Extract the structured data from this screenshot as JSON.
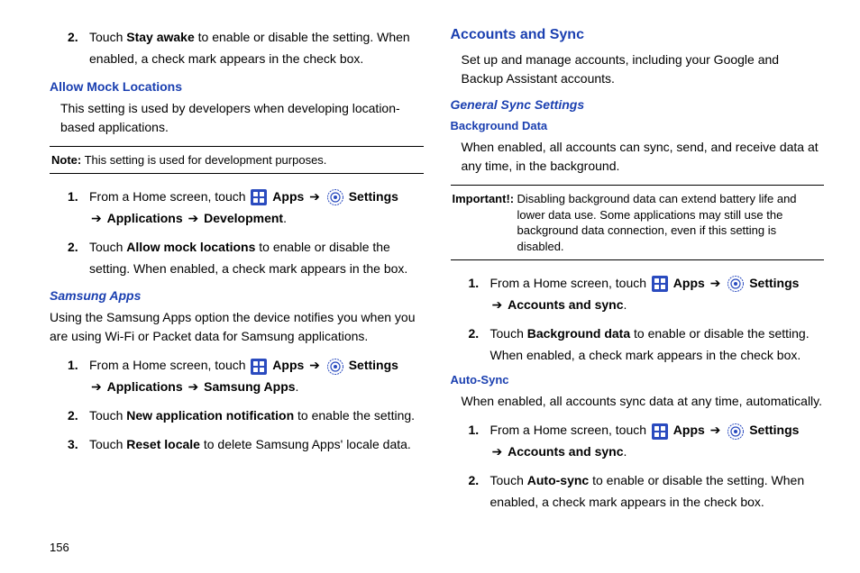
{
  "pagenum": "156",
  "left": {
    "stayawake": {
      "num": "2.",
      "text_a": "Touch ",
      "bold": "Stay awake",
      "text_b": " to enable or disable the setting. When enabled, a check mark appears in the check box."
    },
    "allowmock_head": "Allow Mock Locations",
    "allowmock_para": "This setting is used by developers when developing location-based applications.",
    "note_label": "Note:",
    "note_text": " This setting is used for development purposes.",
    "mock_steps": {
      "s1": {
        "num": "1.",
        "pre": "From a Home screen, touch ",
        "apps": "Apps",
        "sep": " ➔ ",
        "settings": "Settings",
        "sep2": " ➔ ",
        "applications": "Applications",
        "sep3": " ➔ ",
        "dev": "Development",
        "end": "."
      },
      "s2": {
        "num": "2.",
        "pre": "Touch ",
        "bold": "Allow mock locations",
        "post": " to enable or disable the setting. When enabled, a check mark appears in the box."
      }
    },
    "samsung_head": "Samsung Apps",
    "samsung_para": "Using the Samsung Apps option the device notifies you when you are using Wi-Fi or Packet data for Samsung applications.",
    "samsung_steps": {
      "s1": {
        "num": "1.",
        "pre": "From a Home screen, touch ",
        "apps": "Apps",
        "sep": " ➔ ",
        "settings": "Settings",
        "sep2": " ➔ ",
        "applications": "Applications",
        "sep3": " ➔ ",
        "sa": "Samsung Apps",
        "end": "."
      },
      "s2": {
        "num": "2.",
        "pre": "Touch ",
        "bold": "New application notification",
        "post": " to enable the setting."
      },
      "s3": {
        "num": "3.",
        "pre": "Touch ",
        "bold": "Reset locale",
        "post": " to delete Samsung Apps' locale data."
      }
    }
  },
  "right": {
    "accounts_head": "Accounts and Sync",
    "accounts_para": "Set up and manage accounts, including your Google and Backup Assistant accounts.",
    "general_head": "General Sync Settings",
    "bgdata_head": "Background Data",
    "bgdata_para": "When enabled, all accounts can sync, send, and receive data at any time, in the background.",
    "important_label": "Important!:",
    "important_text": "Disabling background data can extend battery life and lower data use. Some applications may still use the background data connection, even if this setting is disabled.",
    "bg_steps": {
      "s1": {
        "num": "1.",
        "pre": "From a Home screen, touch ",
        "apps": "Apps",
        "sep": " ➔ ",
        "settings": "Settings",
        "sep2": " ➔ ",
        "acct": "Accounts and sync",
        "end": "."
      },
      "s2": {
        "num": "2.",
        "pre": "Touch ",
        "bold": "Background data",
        "post": " to enable or disable the setting. When enabled, a check mark appears in the check box."
      }
    },
    "autosync_head": "Auto-Sync",
    "autosync_para": "When enabled, all accounts sync data at any time, automatically.",
    "autosync_steps": {
      "s1": {
        "num": "1.",
        "pre": "From a Home screen, touch ",
        "apps": "Apps",
        "sep": " ➔ ",
        "settings": "Settings",
        "sep2": " ➔ ",
        "acct": "Accounts and sync",
        "end": "."
      },
      "s2": {
        "num": "2.",
        "pre": "Touch ",
        "bold": "Auto-sync",
        "post": " to enable or disable the setting. When enabled, a check mark appears in the check box."
      }
    }
  }
}
